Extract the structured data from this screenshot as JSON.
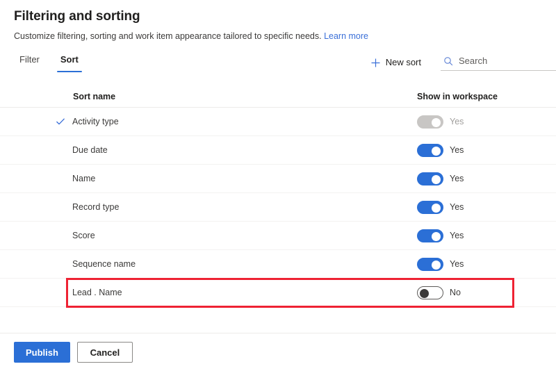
{
  "header": {
    "title": "Filtering and sorting",
    "subtitle": "Customize filtering, sorting and work item appearance tailored to specific needs.",
    "learn_more": "Learn more"
  },
  "tabs": [
    {
      "label": "Filter",
      "active": false
    },
    {
      "label": "Sort",
      "active": true
    }
  ],
  "toolbar": {
    "new_sort_label": "New sort",
    "plus_icon": "plus-icon",
    "search_icon": "search-icon",
    "search_placeholder": "Search",
    "search_value": ""
  },
  "table": {
    "columns": {
      "name": "Sort name",
      "toggle": "Show in workspace"
    },
    "rows": [
      {
        "name": "Activity type",
        "checked": true,
        "toggle_state": "on-disabled",
        "toggle_label": "Yes",
        "highlighted": false
      },
      {
        "name": "Due date",
        "checked": false,
        "toggle_state": "on",
        "toggle_label": "Yes",
        "highlighted": false
      },
      {
        "name": "Name",
        "checked": false,
        "toggle_state": "on",
        "toggle_label": "Yes",
        "highlighted": false
      },
      {
        "name": "Record type",
        "checked": false,
        "toggle_state": "on",
        "toggle_label": "Yes",
        "highlighted": false
      },
      {
        "name": "Score",
        "checked": false,
        "toggle_state": "on",
        "toggle_label": "Yes",
        "highlighted": false
      },
      {
        "name": "Sequence name",
        "checked": false,
        "toggle_state": "on",
        "toggle_label": "Yes",
        "highlighted": false
      },
      {
        "name": "Lead . Name",
        "checked": false,
        "toggle_state": "off",
        "toggle_label": "No",
        "highlighted": true
      }
    ]
  },
  "footer": {
    "publish_label": "Publish",
    "cancel_label": "Cancel"
  },
  "colors": {
    "accent_blue": "#2b6fd6",
    "link_blue": "#3a6fd8",
    "annotation_red": "#ee2233",
    "toggle_off_border": "#5c5a58",
    "toggle_disabled_grey": "#c8c6c4"
  }
}
